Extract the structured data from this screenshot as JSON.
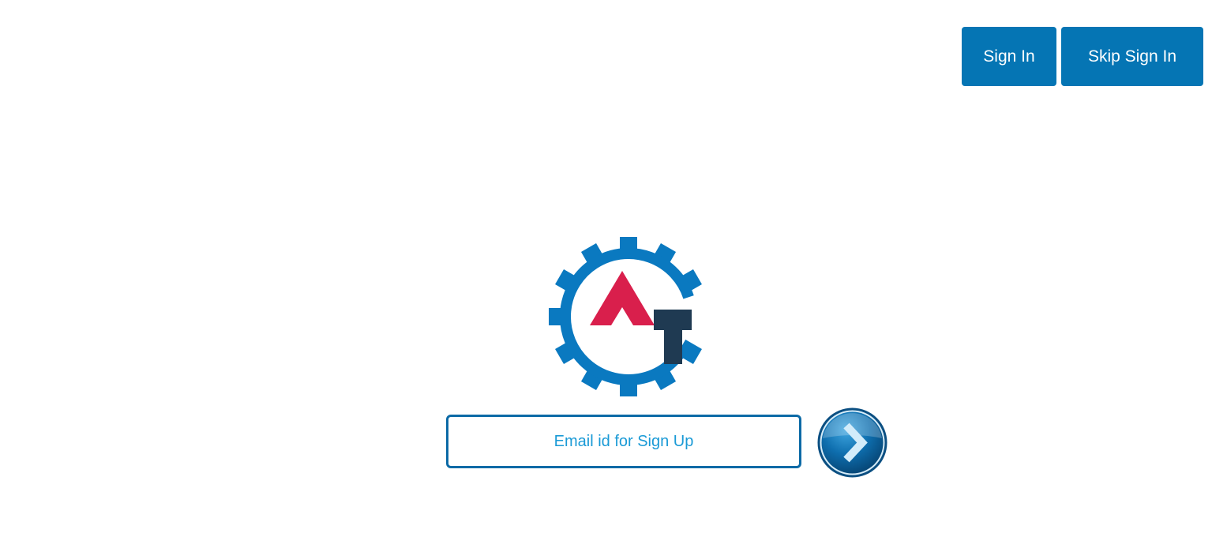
{
  "colors": {
    "primary_button": "#0575b4",
    "gear_blue": "#0a79c0",
    "logo_red": "#d91f4c",
    "logo_navy": "#1f3a52",
    "input_border": "#0c6aa6",
    "placeholder": "#1a9ad6"
  },
  "header": {
    "sign_in_label": "Sign In",
    "skip_sign_in_label": "Skip Sign In"
  },
  "logo": {
    "icon": "gear-at-logo-icon"
  },
  "signup": {
    "email_value": "",
    "email_placeholder": "Email id for Sign Up",
    "submit_icon": "chevron-right-icon"
  }
}
